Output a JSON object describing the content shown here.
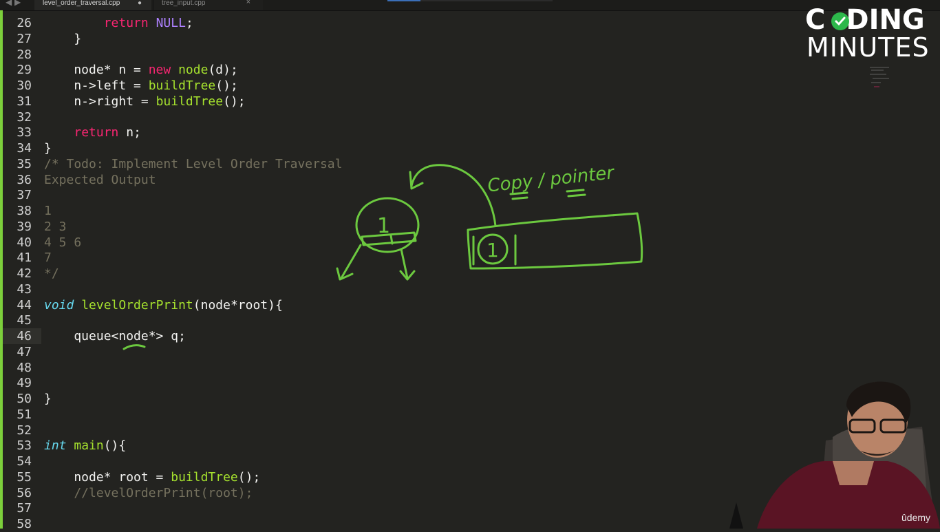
{
  "tabs": [
    {
      "label": "level_order_traversal.cpp",
      "modified_dot": "●"
    },
    {
      "label": "tree_input.cpp",
      "close": "×"
    }
  ],
  "nav_arrows": "◀ ▶",
  "code_lines": [
    {
      "num": "26",
      "tokens": [
        {
          "t": "        ",
          "c": "pl"
        },
        {
          "t": "return",
          "c": "kw"
        },
        {
          "t": " ",
          "c": "pl"
        },
        {
          "t": "NULL",
          "c": "cn"
        },
        {
          "t": ";",
          "c": "pl"
        }
      ]
    },
    {
      "num": "27",
      "tokens": [
        {
          "t": "    }",
          "c": "pl"
        }
      ]
    },
    {
      "num": "28",
      "tokens": []
    },
    {
      "num": "29",
      "tokens": [
        {
          "t": "    node* n = ",
          "c": "pl"
        },
        {
          "t": "new",
          "c": "kw"
        },
        {
          "t": " ",
          "c": "pl"
        },
        {
          "t": "node",
          "c": "fn"
        },
        {
          "t": "(d);",
          "c": "pl"
        }
      ]
    },
    {
      "num": "30",
      "tokens": [
        {
          "t": "    n->left = ",
          "c": "pl"
        },
        {
          "t": "buildTree",
          "c": "fn"
        },
        {
          "t": "();",
          "c": "pl"
        }
      ]
    },
    {
      "num": "31",
      "tokens": [
        {
          "t": "    n->right = ",
          "c": "pl"
        },
        {
          "t": "buildTree",
          "c": "fn"
        },
        {
          "t": "();",
          "c": "pl"
        }
      ]
    },
    {
      "num": "32",
      "tokens": []
    },
    {
      "num": "33",
      "tokens": [
        {
          "t": "    ",
          "c": "pl"
        },
        {
          "t": "return",
          "c": "kw"
        },
        {
          "t": " n;",
          "c": "pl"
        }
      ]
    },
    {
      "num": "34",
      "tokens": [
        {
          "t": "}",
          "c": "pl"
        }
      ]
    },
    {
      "num": "35",
      "tokens": [
        {
          "t": "/* Todo: Implement Level Order Traversal",
          "c": "cm"
        }
      ]
    },
    {
      "num": "36",
      "tokens": [
        {
          "t": "Expected Output",
          "c": "cm"
        }
      ]
    },
    {
      "num": "37",
      "tokens": []
    },
    {
      "num": "38",
      "tokens": [
        {
          "t": "1",
          "c": "cm"
        }
      ]
    },
    {
      "num": "39",
      "tokens": [
        {
          "t": "2 3",
          "c": "cm"
        }
      ]
    },
    {
      "num": "40",
      "tokens": [
        {
          "t": "4 5 6",
          "c": "cm"
        }
      ]
    },
    {
      "num": "41",
      "tokens": [
        {
          "t": "7",
          "c": "cm"
        }
      ]
    },
    {
      "num": "42",
      "tokens": [
        {
          "t": "*/",
          "c": "cm"
        }
      ]
    },
    {
      "num": "43",
      "tokens": []
    },
    {
      "num": "44",
      "tokens": [
        {
          "t": "void",
          "c": "ty"
        },
        {
          "t": " ",
          "c": "pl"
        },
        {
          "t": "levelOrderPrint",
          "c": "fn"
        },
        {
          "t": "(node*root){",
          "c": "pl"
        }
      ]
    },
    {
      "num": "45",
      "tokens": []
    },
    {
      "num": "46",
      "tokens": [
        {
          "t": "    queue<node*> q;",
          "c": "pl"
        }
      ]
    },
    {
      "num": "47",
      "tokens": []
    },
    {
      "num": "48",
      "tokens": []
    },
    {
      "num": "49",
      "tokens": []
    },
    {
      "num": "50",
      "tokens": [
        {
          "t": "}",
          "c": "pl"
        }
      ]
    },
    {
      "num": "51",
      "tokens": []
    },
    {
      "num": "52",
      "tokens": []
    },
    {
      "num": "53",
      "tokens": [
        {
          "t": "int",
          "c": "ty"
        },
        {
          "t": " ",
          "c": "pl"
        },
        {
          "t": "main",
          "c": "fn"
        },
        {
          "t": "(){",
          "c": "pl"
        }
      ]
    },
    {
      "num": "54",
      "tokens": []
    },
    {
      "num": "55",
      "tokens": [
        {
          "t": "    node* root = ",
          "c": "pl"
        },
        {
          "t": "buildTree",
          "c": "fn"
        },
        {
          "t": "();",
          "c": "pl"
        }
      ]
    },
    {
      "num": "56",
      "tokens": [
        {
          "t": "    //levelOrderPrint(root);",
          "c": "cm"
        }
      ]
    },
    {
      "num": "57",
      "tokens": []
    },
    {
      "num": "58",
      "tokens": []
    }
  ],
  "annotation": {
    "handwriting": "Copy / pointer",
    "node_label": "1",
    "queue_item_label": "1",
    "ink_color": "#6cc93f"
  },
  "logo": {
    "line1_a": "C",
    "line1_b": "DING",
    "line2": "MINUTES"
  },
  "watermark": "ûdemy",
  "colors": {
    "background": "#232320",
    "keyword": "#f92672",
    "type": "#66d9ef",
    "function": "#a6e22e",
    "constant": "#ae81ff",
    "comment": "#75715e",
    "left_bar": "#7ccf3b"
  }
}
